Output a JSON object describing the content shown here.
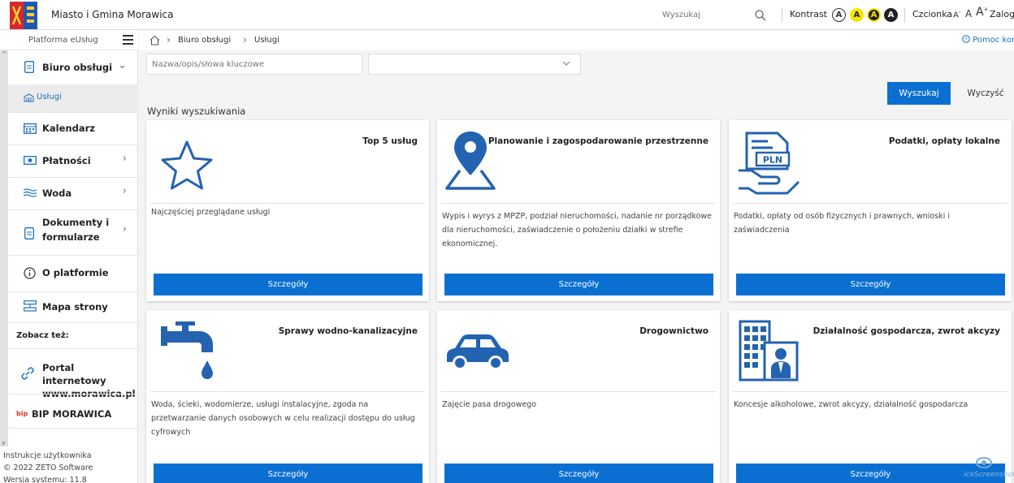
{
  "header": {
    "site_title": "Miasto i Gmina Morawica",
    "search_placeholder": "Wyszukaj",
    "contrast_label": "Kontrast",
    "contrast_buttons": [
      "A",
      "A",
      "A",
      "A"
    ],
    "font_label": "Czcionka",
    "font_sizes": [
      "A",
      "A",
      "A"
    ],
    "font_size_marks": [
      "-",
      "+"
    ],
    "login_label": "Zaloguj"
  },
  "sidebar": {
    "platform_label": "Platforma eUsług",
    "items": [
      {
        "label": "Biuro obsługi",
        "icon": "document-icon",
        "chevron": "down"
      },
      {
        "label": "Kalendarz",
        "icon": "calendar-icon"
      },
      {
        "label": "Płatności",
        "icon": "money-icon",
        "chevron": "right"
      },
      {
        "label": "Woda",
        "icon": "water-icon",
        "chevron": "right"
      },
      {
        "label_line1": "Dokumenty i",
        "label_line2": "formularze",
        "icon": "document-icon",
        "chevron": "right"
      },
      {
        "label": "O platformie",
        "icon": "info-icon"
      },
      {
        "label": "Mapa strony",
        "icon": "sitemap-icon"
      }
    ],
    "subitem": {
      "label": "Usługi",
      "icon": "services-icon"
    },
    "see_also_label": "Zobacz też:",
    "portal_label_line1": "Portal internetowy",
    "portal_label_line2": "www.morawica.pl",
    "bip_logo": "bip",
    "bip_label": "BIP MORAWICA",
    "footer": {
      "manual": "Instrukcje użytkownika",
      "copyright": "© 2022 ZETO Software",
      "version": "Wersja systemu: 11.8"
    }
  },
  "breadcrumb": {
    "items": [
      "Biuro obsługi",
      "Usługi"
    ],
    "help_label": "Pomoc kontekstowa"
  },
  "filters": {
    "keyword_placeholder": "Nazwa/opis/słowa kluczowe",
    "category_value": "",
    "search_button": "Wyszukaj",
    "clear_button": "Wyczyść"
  },
  "results": {
    "heading": "Wyniki wyszukiwania",
    "button_label": "Szczegóły",
    "cards": [
      {
        "title": "Top 5 usług",
        "description": "Najczęściej przeglądane usługi",
        "icon": "star-icon"
      },
      {
        "title": "Planowanie i zagospodarowanie przestrzenne",
        "description": "Wypis i wyrys z MPZP, podział nieruchomości, nadanie nr porządkowe dla nieruchomości, zaświadczenie o położeniu działki w strefie ekonomicznej.",
        "icon": "map-pin-icon"
      },
      {
        "title": "Podatki, opłaty lokalne",
        "description": "Podatki, opłaty od osób fizycznych i prawnych, wnioski i zaświadczenia",
        "icon": "tax-invoice-icon",
        "icon_text": "PLN"
      },
      {
        "title": "Sprawy wodno-kanalizacyjne",
        "description": "Woda, ścieki, wodomierze, usługi instalacyjne, zgoda na przetwarzanie danych osobowych w celu realizacji dostępu do usług cyfrowych",
        "icon": "water-tap-icon"
      },
      {
        "title": "Drogownictwo",
        "description": "Zajęcie pasa drogowego",
        "icon": "car-icon"
      },
      {
        "title": "Działalność gospodarcza, zwrot akcyzy",
        "description": "Koncesje alkoholowe, zwrot akcyzy, działalność gospodarcza",
        "icon": "business-building-icon"
      }
    ]
  },
  "watermark": "iceScreenshot",
  "colors": {
    "accent": "#0a6fd1",
    "link": "#1a6fbf",
    "contrast_yellow": "#f5e600"
  }
}
